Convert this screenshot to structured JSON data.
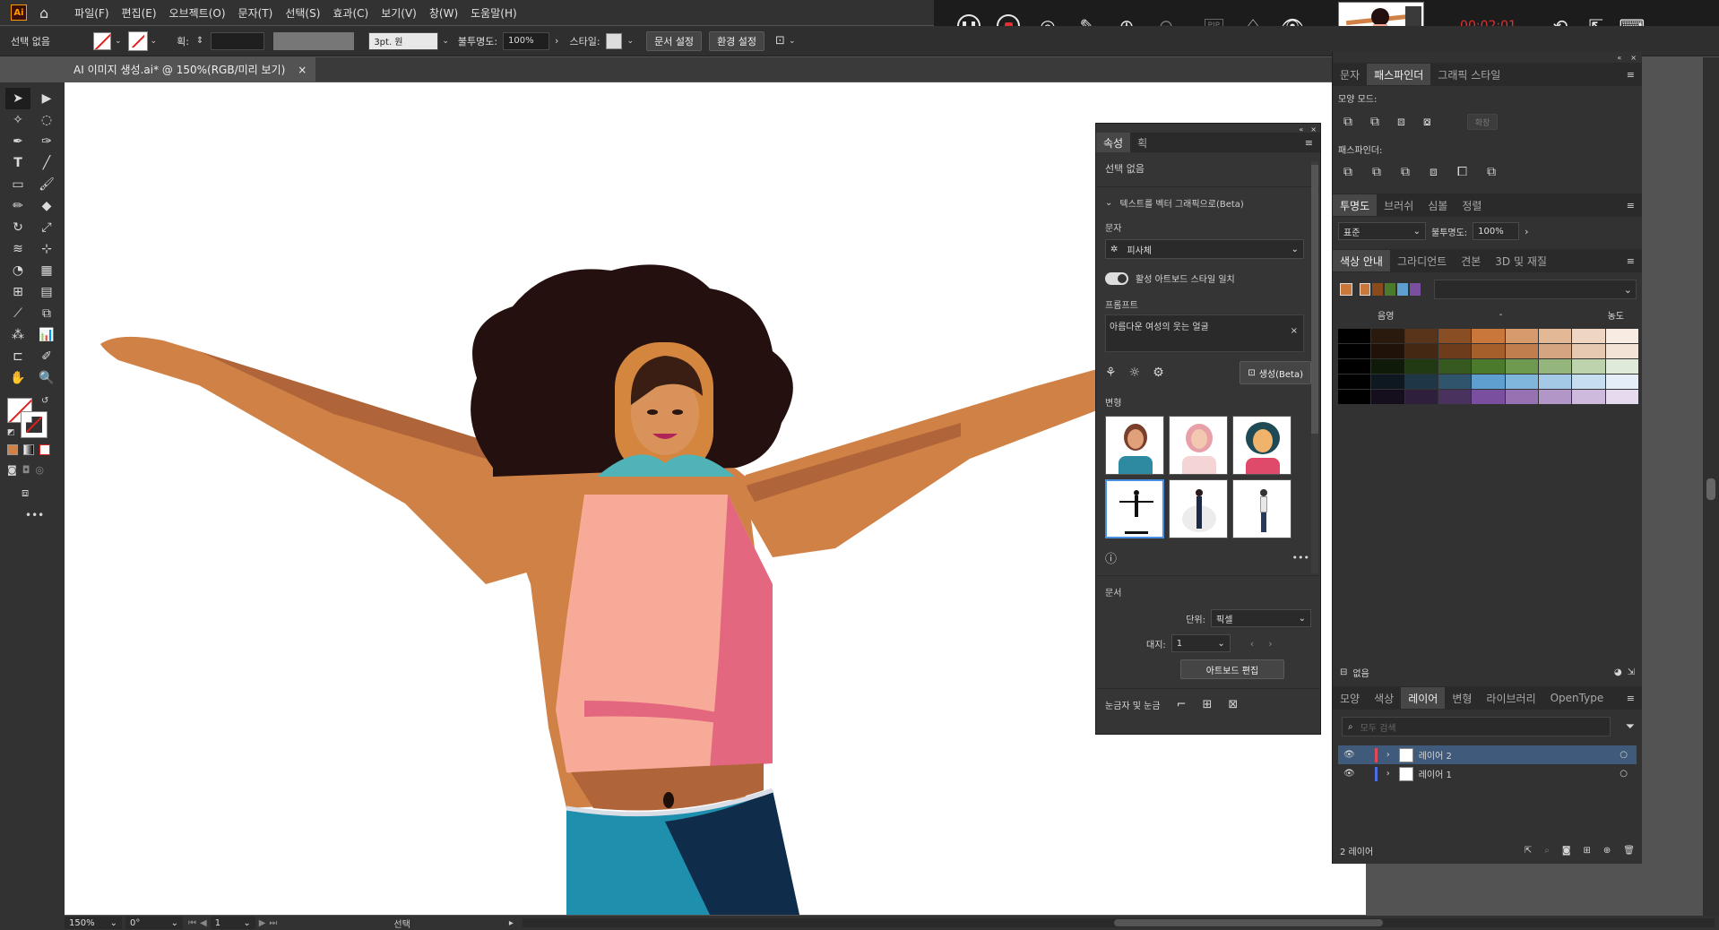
{
  "app": {
    "logo": "Ai"
  },
  "menu": [
    "파일(F)",
    "편집(E)",
    "오브젝트(O)",
    "문자(T)",
    "선택(S)",
    "효과(C)",
    "보기(V)",
    "창(W)",
    "도움말(H)"
  ],
  "control": {
    "selection": "선택 없음",
    "stroke_label": "획:",
    "brush": "3pt. 원",
    "opacity_label": "불투명도:",
    "opacity": "100%",
    "style_label": "스타일:",
    "doc_setup": "문서 설정",
    "prefs": "환경 설정"
  },
  "doc_tab": {
    "title": "AI 이미지 생성.ai* @ 150%(RGB/미리 보기)",
    "close": "×"
  },
  "recorder": {
    "time": "00:02:01",
    "zoom": "x1",
    "pip": "PIP"
  },
  "props_panel": {
    "tabs": [
      "속성",
      "획"
    ],
    "no_selection": "선택 없음",
    "section_title": "텍스트를 벡터 그래픽으로(Beta)",
    "type_label": "문자",
    "type_value": "피사체",
    "match_toggle": "활성 아트보드 스타일 일치",
    "prompt_label": "프롬프트",
    "prompt_text": "아름다운 여성의 웃는 얼굴",
    "generate": "생성(Beta)",
    "variants_label": "변형",
    "doc_label": "문서",
    "unit_label": "단위:",
    "unit_value": "픽셀",
    "artboard_label": "대지:",
    "artboard_value": "1",
    "edit_artboard": "아트보드 편집",
    "rulers_label": "눈금자 및 눈금"
  },
  "dock": {
    "group1_tabs": [
      "문자",
      "패스파인더",
      "그래픽 스타일"
    ],
    "shape_modes": "모양 모드:",
    "expand": "확장",
    "pathfinders": "패스파인더:",
    "group2_tabs": [
      "투명도",
      "브러쉬",
      "심볼",
      "정렬"
    ],
    "blend_mode": "표준",
    "opacity_label": "불투명도:",
    "opacity": "100%",
    "group3_tabs": [
      "색상 안내",
      "그라디언트",
      "견본",
      "3D 및 재질"
    ],
    "guide_left": "음영",
    "guide_mid": "-",
    "guide_right": "농도",
    "guide_footer": "없음",
    "base_colors": [
      "#c9773a",
      "#c9773a",
      "#8a4a1c",
      "#4b7a2d",
      "#5e9fcf",
      "#7b4f9f"
    ],
    "guide_grid": [
      [
        "#000000",
        "#2a1a0e",
        "#5a341a",
        "#8a4e24",
        "#c9773a",
        "#d79a6c",
        "#e3b896",
        "#efd6c2",
        "#f7ebe2"
      ],
      [
        "#000000",
        "#201208",
        "#452814",
        "#6c3c1c",
        "#a55f2b",
        "#c07e4e",
        "#d5a582",
        "#e7c9b2",
        "#f3e3d7"
      ],
      [
        "#000000",
        "#0f1a09",
        "#213a13",
        "#35591f",
        "#4b7a2d",
        "#6e9a50",
        "#94b67c",
        "#bdd3ad",
        "#dfeada"
      ],
      [
        "#000000",
        "#0e1820",
        "#1e3646",
        "#30546b",
        "#5e9fcf",
        "#80b5dc",
        "#a3c9e6",
        "#c6def0",
        "#e3eef8"
      ],
      [
        "#000000",
        "#150e1c",
        "#2e1f3d",
        "#4a325f",
        "#7b4f9f",
        "#9672b3",
        "#b296c8",
        "#cdbadc",
        "#e6dbee"
      ]
    ],
    "group4_tabs": [
      "모양",
      "색상",
      "레이어",
      "변형",
      "라이브러리",
      "OpenType"
    ],
    "search_placeholder": "모두 검색",
    "layers": [
      {
        "name": "레이어 2",
        "color": "#e0495a"
      },
      {
        "name": "레이어 1",
        "color": "#4a6fe0"
      }
    ],
    "layer_count": "2 레이어"
  },
  "status": {
    "zoom": "150%",
    "angle": "0°",
    "page": "1",
    "mode": "선택"
  },
  "colors": {
    "skin": "#d08246",
    "skin_dark": "#b0643a",
    "hair": "#24110f",
    "top": "#f8aa98",
    "top_dark": "#e3687f",
    "pants": "#1e8fad",
    "pants_dark": "#0f2c4a"
  }
}
